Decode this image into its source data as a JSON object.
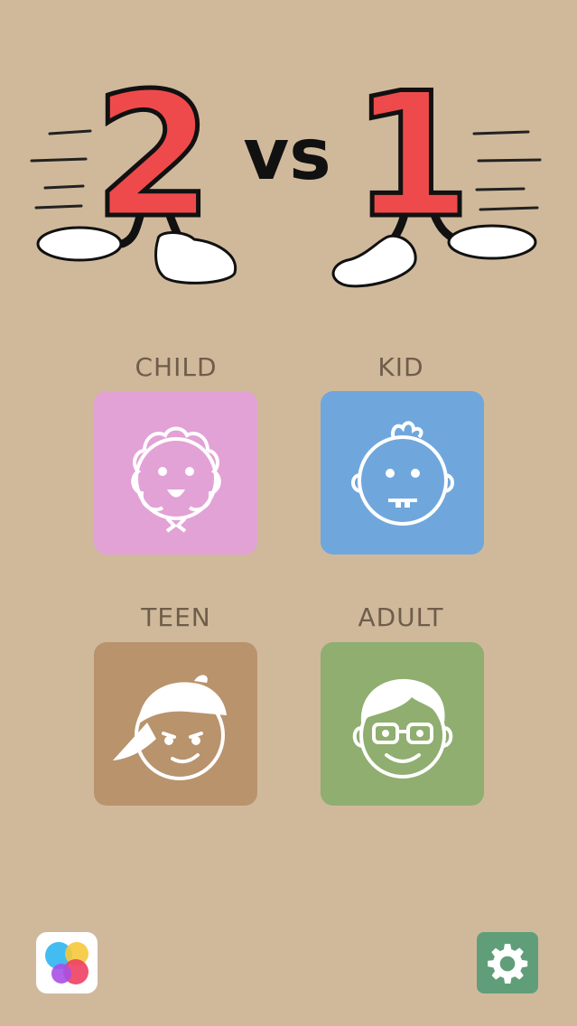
{
  "logo": {
    "left_number": "2",
    "vs": "vs",
    "right_number": "1"
  },
  "categories": [
    {
      "label": "CHILD",
      "color": "#e2a2d6",
      "icon": "baby-face-icon"
    },
    {
      "label": "KID",
      "color": "#6fa7dd",
      "icon": "kid-face-icon"
    },
    {
      "label": "TEEN",
      "color": "#b9936c",
      "icon": "teen-cap-face-icon"
    },
    {
      "label": "ADULT",
      "color": "#8fae6f",
      "icon": "adult-glasses-face-icon"
    }
  ],
  "bottom": {
    "game_center_icon": "game-center-icon",
    "settings_icon": "gear-icon",
    "settings_color": "#5f9e79"
  },
  "colors": {
    "background": "#d0b99b",
    "logo_red": "#ef4a4b"
  }
}
